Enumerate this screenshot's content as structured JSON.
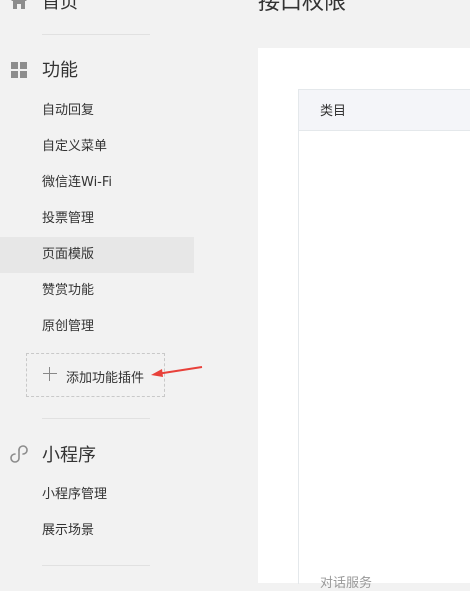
{
  "sidebar": {
    "home": {
      "label": "首页",
      "icon": "home-icon"
    },
    "features": {
      "label": "功能",
      "icon": "grid-icon",
      "items": [
        "自动回复",
        "自定义菜单",
        "微信连Wi-Fi",
        "投票管理",
        "页面模版",
        "赞赏功能",
        "原创管理"
      ],
      "active_index": 4,
      "add_plugin_label": "添加功能插件"
    },
    "miniprogram": {
      "label": "小程序",
      "icon": "link-icon",
      "items": [
        "小程序管理",
        "展示场景"
      ]
    }
  },
  "main": {
    "title": "接口权限",
    "table": {
      "header": "类目",
      "row_partial": "对话服务"
    }
  },
  "colors": {
    "annotation_arrow": "#e8413a",
    "active_bg": "#e7e7e7",
    "page_bg": "#f2f2f2"
  }
}
